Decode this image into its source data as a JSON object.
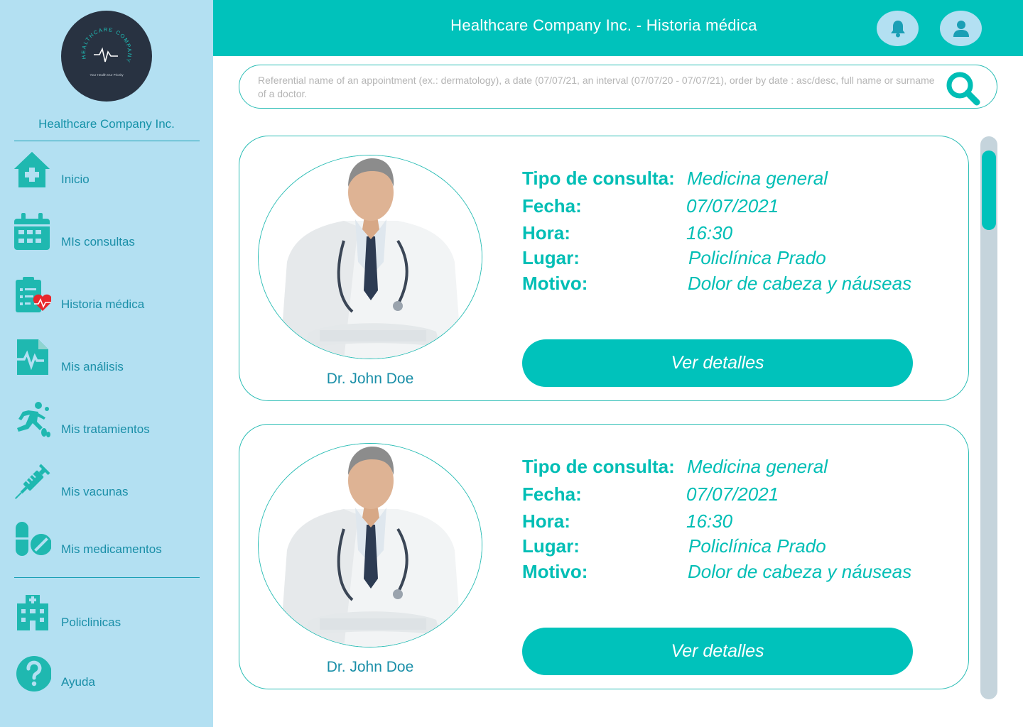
{
  "colors": {
    "accent": "#00c2bb",
    "sidebar_bg": "#b3e0f2",
    "logo_bg": "#283241",
    "alert_red": "#e8262c"
  },
  "sidebar": {
    "logo_text": "HEALTHCARE COMPANY",
    "logo_tagline": "Your Health Our Priority",
    "company_name": "Healthcare Company Inc.",
    "items": [
      {
        "label": "Inicio",
        "icon": "home-plus-icon"
      },
      {
        "label": "MIs consultas",
        "icon": "calendar-icon"
      },
      {
        "label": "Historia médica",
        "icon": "clipboard-heart-icon"
      },
      {
        "label": "Mis análisis",
        "icon": "file-pulse-icon"
      },
      {
        "label": "Mis tratamientos",
        "icon": "running-person-icon"
      },
      {
        "label": "Mis vacunas",
        "icon": "syringe-icon"
      },
      {
        "label": "Mis  medicamentos",
        "icon": "pills-icon"
      }
    ],
    "footer_items": [
      {
        "label": "Policlinicas",
        "icon": "hospital-icon"
      },
      {
        "label": "Ayuda",
        "icon": "question-icon"
      }
    ]
  },
  "header": {
    "title": "Healthcare Company Inc. - Historia médica",
    "notification_icon": "bell-icon",
    "profile_icon": "user-icon"
  },
  "search": {
    "placeholder": "Referential name of an appointment (ex.: dermatology), a date (07/07/21, an interval (07/07/20 - 07/07/21), order by date : asc/desc, full name or surname of a doctor.",
    "value": "",
    "icon": "search-icon"
  },
  "labels": {
    "type": "Tipo de consulta:",
    "date": "Fecha:",
    "time": "Hora:",
    "place": "Lugar:",
    "reason": "Motivo:"
  },
  "records": [
    {
      "doctor": "Dr. John Doe",
      "type": "Medicina general",
      "date": "07/07/2021",
      "time": "16:30",
      "place": "Policlínica Prado",
      "reason": "Dolor de cabeza y náuseas",
      "button": "Ver detalles"
    },
    {
      "doctor": "Dr. John Doe",
      "type": "Medicina general",
      "date": "07/07/2021",
      "time": "16:30",
      "place": "Policlínica Prado",
      "reason": "Dolor de cabeza y náuseas",
      "button": "Ver detalles"
    }
  ]
}
